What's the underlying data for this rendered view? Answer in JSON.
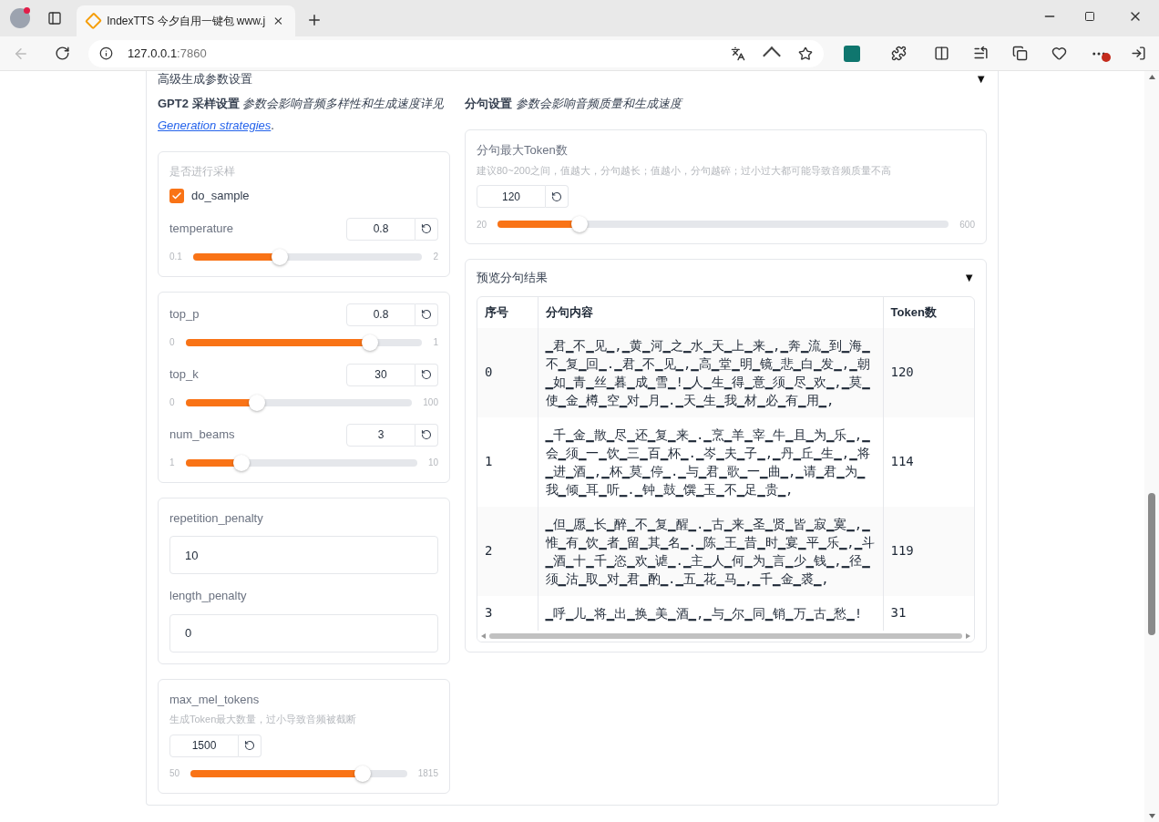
{
  "browser": {
    "tab_title": "IndexTTS 今夕自用一键包 www.j",
    "address_host": "127.0.0.1",
    "address_port": ":7860"
  },
  "settings": {
    "title": "高级生成参数设置",
    "expanded": true,
    "toggle": "▼",
    "left": {
      "description": "**GPT2 采样设置** *参数会影响音频多样性和生成速度详见*",
      "link": "Generation strategies",
      "description_end": ".",
      "groups": [
        {
          "items": [
            {
              "kind": "checkbox",
              "label": "是否进行采样",
              "option": "do_sample",
              "checked": true
            },
            {
              "kind": "slider",
              "label": "temperature",
              "value": "0.8",
              "min": "0.1",
              "max": "2",
              "level": 0.37
            }
          ]
        },
        {
          "items": [
            {
              "kind": "slider",
              "label": "top_p",
              "value": "0.8",
              "min": "0",
              "max": "1",
              "level": 0.8
            },
            {
              "kind": "slider",
              "label": "top_k",
              "value": "30",
              "min": "0",
              "max": "100",
              "level": 0.3
            },
            {
              "kind": "slider",
              "label": "num_beams",
              "value": "3",
              "min": "1",
              "max": "10",
              "level": 0.22
            }
          ]
        },
        {
          "items": [
            {
              "kind": "number",
              "label": "repetition_penalty",
              "value": "10"
            },
            {
              "kind": "number",
              "label": "length_penalty",
              "value": "0"
            }
          ]
        },
        {
          "items": [
            {
              "kind": "slider",
              "label": "max_mel_tokens",
              "info": "生成Token最大数量，过小导致音频被截断",
              "value": "1500",
              "min": "50",
              "max": "1815",
              "level": 0.82
            }
          ]
        }
      ]
    },
    "right": {
      "description": "**分句设置** *参数会影响音频质量和生成速度*",
      "groups": [
        {
          "items": [
            {
              "kind": "slider",
              "label": "分句最大Token数",
              "info": "建议80~200之间，值越大，分句越长；值越小，分句越碎；过小过大都可能导致音频质量不高",
              "value": "120",
              "min": "20",
              "max": "600",
              "level": 0.17
            }
          ]
        }
      ],
      "preview": {
        "title": "预览分句结果",
        "expanded": true,
        "toggle": "▼",
        "columns": [
          "序号",
          "分句内容",
          "Token数"
        ],
        "rows": [
          [
            "0",
            "▁君▁不▁见▁,▁黄▁河▁之▁水▁天▁上▁来▁,▁奔▁流▁到▁海▁不▁复▁回▁.▁君▁不▁见▁,▁高▁堂▁明▁镜▁悲▁白▁发▁,▁朝▁如▁青▁丝▁暮▁成▁雪▁!▁人▁生▁得▁意▁须▁尽▁欢▁,▁莫▁使▁金▁樽▁空▁对▁月▁.▁天▁生▁我▁材▁必▁有▁用▁,",
            "120"
          ],
          [
            "1",
            "▁千▁金▁散▁尽▁还▁复▁来▁.▁烹▁羊▁宰▁牛▁且▁为▁乐▁,▁会▁须▁一▁饮▁三▁百▁杯▁.▁岑▁夫▁子▁,▁丹▁丘▁生▁,▁将▁进▁酒▁,▁杯▁莫▁停▁.▁与▁君▁歌▁一▁曲▁,▁请▁君▁为▁我▁倾▁耳▁听▁.▁钟▁鼓▁馔▁玉▁不▁足▁贵▁,",
            "114"
          ],
          [
            "2",
            "▁但▁愿▁长▁醉▁不▁复▁醒▁.▁古▁来▁圣▁贤▁皆▁寂▁寞▁,▁惟▁有▁饮▁者▁留▁其▁名▁.▁陈▁王▁昔▁时▁宴▁平▁乐▁,▁斗▁酒▁十▁千▁恣▁欢▁谑▁.▁主▁人▁何▁为▁言▁少▁钱▁,▁径▁须▁沽▁取▁对▁君▁酌▁.▁五▁花▁马▁,▁千▁金▁裘▁,",
            "119"
          ],
          [
            "3",
            "▁呼▁儿▁将▁出▁换▁美▁酒▁,▁与▁尔▁同▁销▁万▁古▁愁▁!",
            "31"
          ]
        ]
      }
    }
  }
}
